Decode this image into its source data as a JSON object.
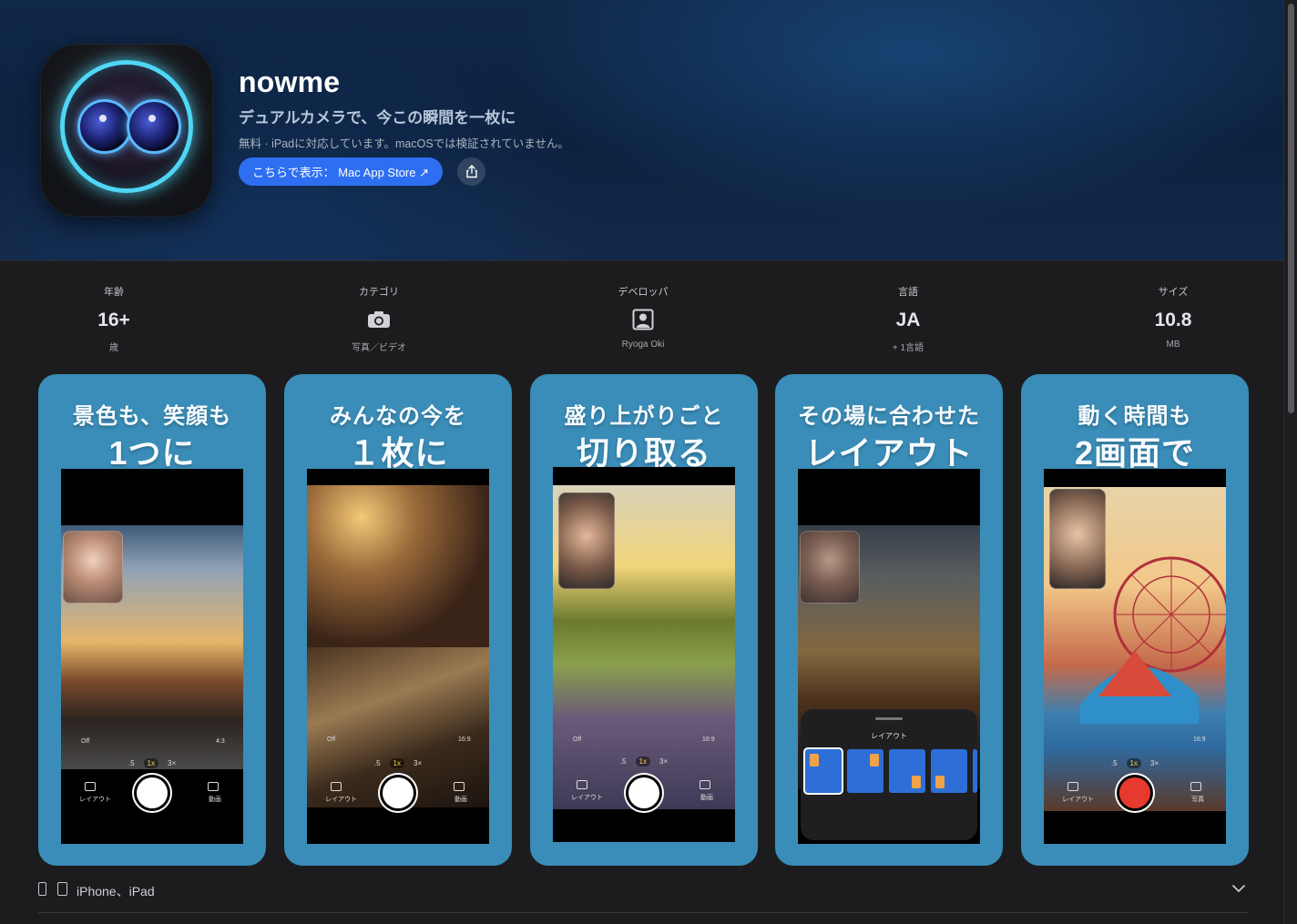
{
  "app": {
    "title": "nowme",
    "subtitle": "デュアルカメラで、今この瞬間を一枚に",
    "meta": "無料 · iPadに対応しています。macOSでは検証されていません。",
    "store_button": "こちらで表示： Mac App Store ↗",
    "icon": "dual-camera-app-icon",
    "share_icon": "share-icon"
  },
  "info": [
    {
      "label": "年齢",
      "value": "16+",
      "sub": "歳"
    },
    {
      "label": "カテゴリ",
      "icon": "camera-icon",
      "sub": "写真／ビデオ"
    },
    {
      "label": "デベロッパ",
      "icon": "person-icon",
      "sub": "Ryoga Oki"
    },
    {
      "label": "言語",
      "value": "JA",
      "sub": "+ 1言語"
    },
    {
      "label": "サイズ",
      "value": "10.8",
      "sub": "MB"
    }
  ],
  "screenshots": [
    {
      "line1": "景色も、笑顔も",
      "line2": "1つに",
      "ratio": "4:3",
      "flash": "Off",
      "zoom": [
        ".5",
        "1x",
        "3×"
      ],
      "left_label": "レイアウト",
      "right_label": "動画"
    },
    {
      "line1": "みんなの今を",
      "line2": "１枚に",
      "ratio": "16:9",
      "flash": "Off",
      "zoom": [
        ".5",
        "1x",
        "3×"
      ],
      "left_label": "レイアウト",
      "right_label": "動画"
    },
    {
      "line1": "盛り上がりごと",
      "line2": "切り取る",
      "ratio": "16:9",
      "flash": "Off",
      "zoom": [
        ".5",
        "1x",
        "3×"
      ],
      "left_label": "レイアウト",
      "right_label": "動画"
    },
    {
      "line1": "その場に合わせた",
      "line2": "レイアウト",
      "panel_title": "レイアウト"
    },
    {
      "line1": "動く時間も",
      "line2": "2画面で",
      "ratio": "16:9",
      "zoom": [
        ".5",
        "1x",
        "3×"
      ],
      "left_label": "レイアウト",
      "right_label": "写真"
    }
  ],
  "footer": {
    "devices": "iPhone、iPad",
    "icons": [
      "iphone-icon",
      "ipad-icon",
      "chevron-down-icon"
    ]
  },
  "colors": {
    "accent_button": "#2e6ff2",
    "screenshot_bg": "#3a8db8",
    "icon_ring": "#4fd6f5"
  }
}
